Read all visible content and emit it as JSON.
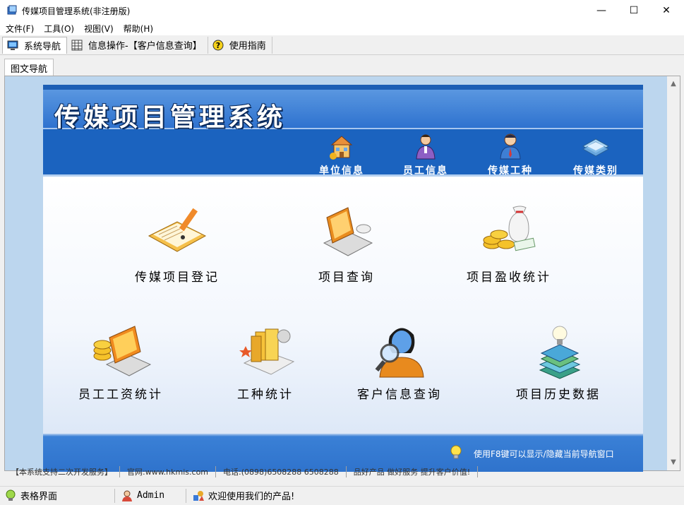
{
  "window": {
    "title": "传媒项目管理系统(非注册版)",
    "minimize": "—",
    "maximize": "☐",
    "close": "✕"
  },
  "menu": [
    "文件(F)",
    "工具(O)",
    "视图(V)",
    "帮助(H)"
  ],
  "tabs": [
    {
      "label": "系统导航",
      "icon": "monitor-icon"
    },
    {
      "label": "信息操作-【客户信息查询】",
      "icon": "grid-icon"
    },
    {
      "label": "使用指南",
      "icon": "help-icon"
    }
  ],
  "subtab": {
    "label": "图文导航"
  },
  "panel": {
    "title": "传媒项目管理系统",
    "nav": [
      {
        "label": "单位信息",
        "icon": "building-icon"
      },
      {
        "label": "员工信息",
        "icon": "employee-icon"
      },
      {
        "label": "传媒工种",
        "icon": "worker-icon"
      },
      {
        "label": "传媒类别",
        "icon": "category-icon"
      }
    ],
    "functions": [
      {
        "label": "传媒项目登记",
        "icon": "register-icon"
      },
      {
        "label": "项目查询",
        "icon": "laptop-search-icon"
      },
      {
        "label": "项目盈收统计",
        "icon": "money-bag-icon"
      },
      {
        "label": "员工工资统计",
        "icon": "salary-icon"
      },
      {
        "label": "工种统计",
        "icon": "files-icon"
      },
      {
        "label": "客户信息查询",
        "icon": "customer-search-icon"
      },
      {
        "label": "项目历史数据",
        "icon": "books-icon"
      }
    ],
    "tip": "使用F8键可以显示/隐藏当前导航窗口"
  },
  "infobar": [
    "【本系统支持二次开发服务】",
    "官网:www.hkmis.com",
    "电话:(0898)6508288 6508288",
    "品好产品 做好服务 提升客户价值!"
  ],
  "status": {
    "view": "表格界面",
    "user": "Admin",
    "message": "欢迎使用我们的产品!"
  },
  "colors": {
    "header_blue": "#2e72cf",
    "nav_blue": "#1b63bf",
    "content_bg": "#bcd6ee"
  }
}
